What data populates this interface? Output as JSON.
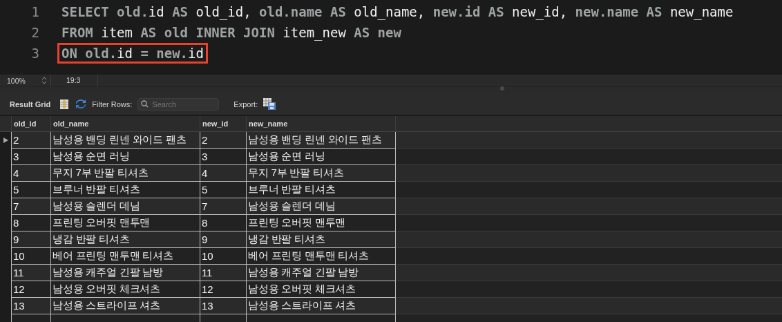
{
  "editor": {
    "lines": [
      {
        "number": "1",
        "highlighted": false,
        "tokens": [
          {
            "text": "SELECT old.",
            "kind": "keyword"
          },
          {
            "text": "id",
            "kind": "ident"
          },
          {
            "text": " AS ",
            "kind": "keyword"
          },
          {
            "text": "old_id, ",
            "kind": "ident"
          },
          {
            "text": "old.name",
            "kind": "keyword"
          },
          {
            "text": " AS ",
            "kind": "keyword"
          },
          {
            "text": "old_name, ",
            "kind": "ident"
          },
          {
            "text": "new.id",
            "kind": "keyword"
          },
          {
            "text": " AS ",
            "kind": "keyword"
          },
          {
            "text": "new_id, ",
            "kind": "ident"
          },
          {
            "text": "new.name",
            "kind": "keyword"
          },
          {
            "text": " AS ",
            "kind": "keyword"
          },
          {
            "text": "new_name",
            "kind": "ident"
          }
        ]
      },
      {
        "number": "2",
        "highlighted": false,
        "tokens": [
          {
            "text": "FROM ",
            "kind": "keyword"
          },
          {
            "text": "item",
            "kind": "ident"
          },
          {
            "text": " AS old INNER JOIN ",
            "kind": "keyword"
          },
          {
            "text": "item_new",
            "kind": "ident"
          },
          {
            "text": " AS new",
            "kind": "keyword"
          }
        ]
      },
      {
        "number": "3",
        "highlighted": true,
        "tokens": [
          {
            "text": "ON old.",
            "kind": "keyword"
          },
          {
            "text": "id",
            "kind": "ident"
          },
          {
            "text": " = new.",
            "kind": "keyword"
          },
          {
            "text": "id",
            "kind": "ident"
          }
        ]
      }
    ]
  },
  "status_bar": {
    "zoom": "100%",
    "position": "19:3"
  },
  "toolbar": {
    "title": "Result Grid",
    "filter_label": "Filter Rows:",
    "search": {
      "placeholder": "Search"
    },
    "export_label": "Export:"
  },
  "table": {
    "columns": [
      "old_id",
      "old_name",
      "new_id",
      "new_name"
    ],
    "rows": [
      {
        "selected": true,
        "cells": [
          "2",
          "남성용 밴딩 린넨 와이드 팬츠",
          "2",
          "남성용 밴딩 린넨 와이드 팬츠"
        ]
      },
      {
        "selected": false,
        "cells": [
          "3",
          "남성용 순면 러닝",
          "3",
          "남성용 순면 러닝"
        ]
      },
      {
        "selected": false,
        "cells": [
          "4",
          "무지 7부 반팔 티셔츠",
          "4",
          "무지 7부 반팔 티셔츠"
        ]
      },
      {
        "selected": false,
        "cells": [
          "5",
          "브루너 반팔 티셔츠",
          "5",
          "브루너 반팔 티셔츠"
        ]
      },
      {
        "selected": false,
        "cells": [
          "7",
          "남성용 슬렌더 데님",
          "7",
          "남성용 슬렌더 데님"
        ]
      },
      {
        "selected": false,
        "cells": [
          "8",
          "프린팅 오버핏 맨투맨",
          "8",
          "프린팅 오버핏 맨투맨"
        ]
      },
      {
        "selected": false,
        "cells": [
          "9",
          "냉감 반팔 티셔츠",
          "9",
          "냉감 반팔 티셔츠"
        ]
      },
      {
        "selected": false,
        "cells": [
          "10",
          "베어 프린팅 맨투맨 티셔츠",
          "10",
          "베어 프린팅 맨투맨 티셔츠"
        ]
      },
      {
        "selected": false,
        "cells": [
          "11",
          "남성용 캐주얼 긴팔 남방",
          "11",
          "남성용 캐주얼 긴팔 남방"
        ]
      },
      {
        "selected": false,
        "cells": [
          "12",
          "남성용 오버핏 체크셔츠",
          "12",
          "남성용 오버핏 체크셔츠"
        ]
      },
      {
        "selected": false,
        "cells": [
          "13",
          "남성용 스트라이프 셔츠",
          "13",
          "남성용 스트라이프 셔츠"
        ]
      }
    ]
  }
}
